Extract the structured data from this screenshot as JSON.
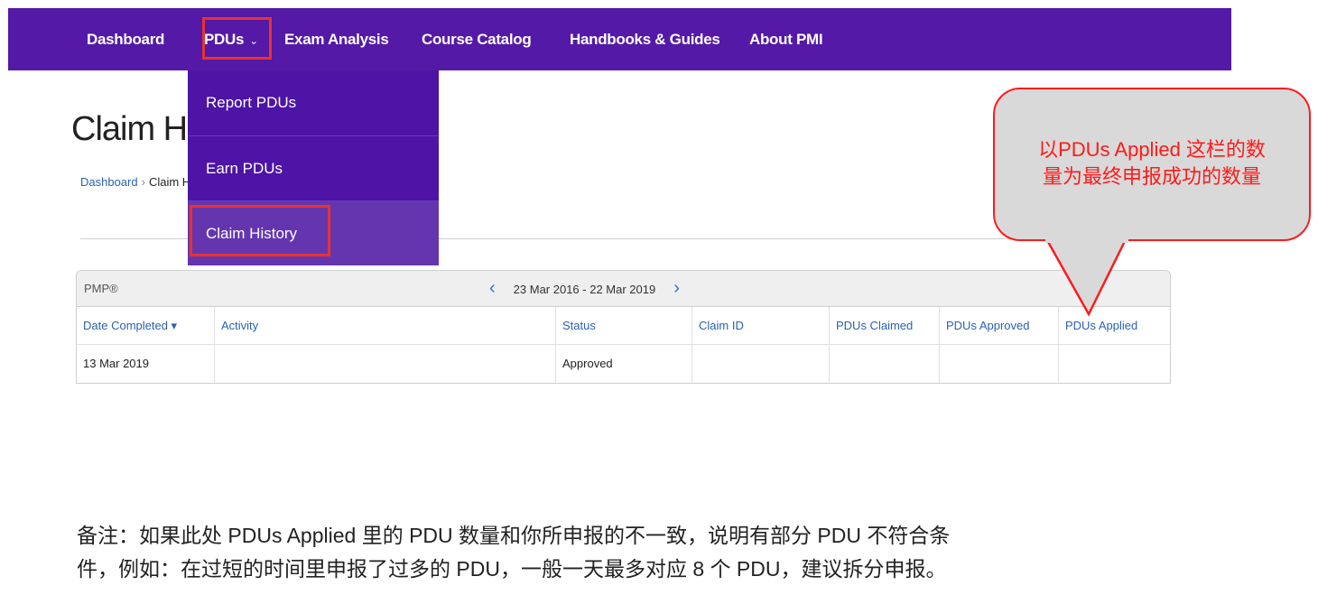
{
  "nav": {
    "items": [
      {
        "label": "Dashboard"
      },
      {
        "label": "PDUs"
      },
      {
        "label": "Exam Analysis"
      },
      {
        "label": "Course Catalog"
      },
      {
        "label": "Handbooks & Guides"
      },
      {
        "label": "About PMI"
      }
    ],
    "pdus_chevron": "⌄"
  },
  "dropdown": {
    "items": [
      {
        "label": "Report PDUs"
      },
      {
        "label": "Earn PDUs"
      },
      {
        "label": "Claim History"
      }
    ]
  },
  "page": {
    "title": "Claim His",
    "breadcrumb": {
      "home": "Dashboard",
      "separator": "›",
      "current": "Claim His"
    }
  },
  "table": {
    "certification": "PMP®",
    "date_range": "23 Mar 2016 - 22 Mar 2019",
    "prev_arrow": "‹",
    "next_arrow": "›",
    "columns": [
      "Date Completed ▾",
      "Activity",
      "Status",
      "Claim ID",
      "PDUs Claimed",
      "PDUs Approved",
      "PDUs Applied"
    ],
    "rows": [
      {
        "date": "13 Mar 2019",
        "activity": "",
        "status": "Approved",
        "claim_id": "",
        "claimed": "",
        "approved": "",
        "applied": ""
      }
    ]
  },
  "callout": {
    "line1": "以PDUs Applied 这栏的数",
    "line2": "量为最终申报成功的数量"
  },
  "note": {
    "line1": "备注：如果此处 PDUs Applied 里的 PDU 数量和你所申报的不一致，说明有部分 PDU 不符合条",
    "line2": "件，例如：在过短的时间里申报了过多的 PDU，一般一天最多对应 8 个 PDU，建议拆分申报。"
  },
  "colors": {
    "nav_bg": "#5419a6",
    "dropdown_bg": "#4d14a6",
    "highlight_red": "#e8322f",
    "link_blue": "#2a62b0"
  }
}
